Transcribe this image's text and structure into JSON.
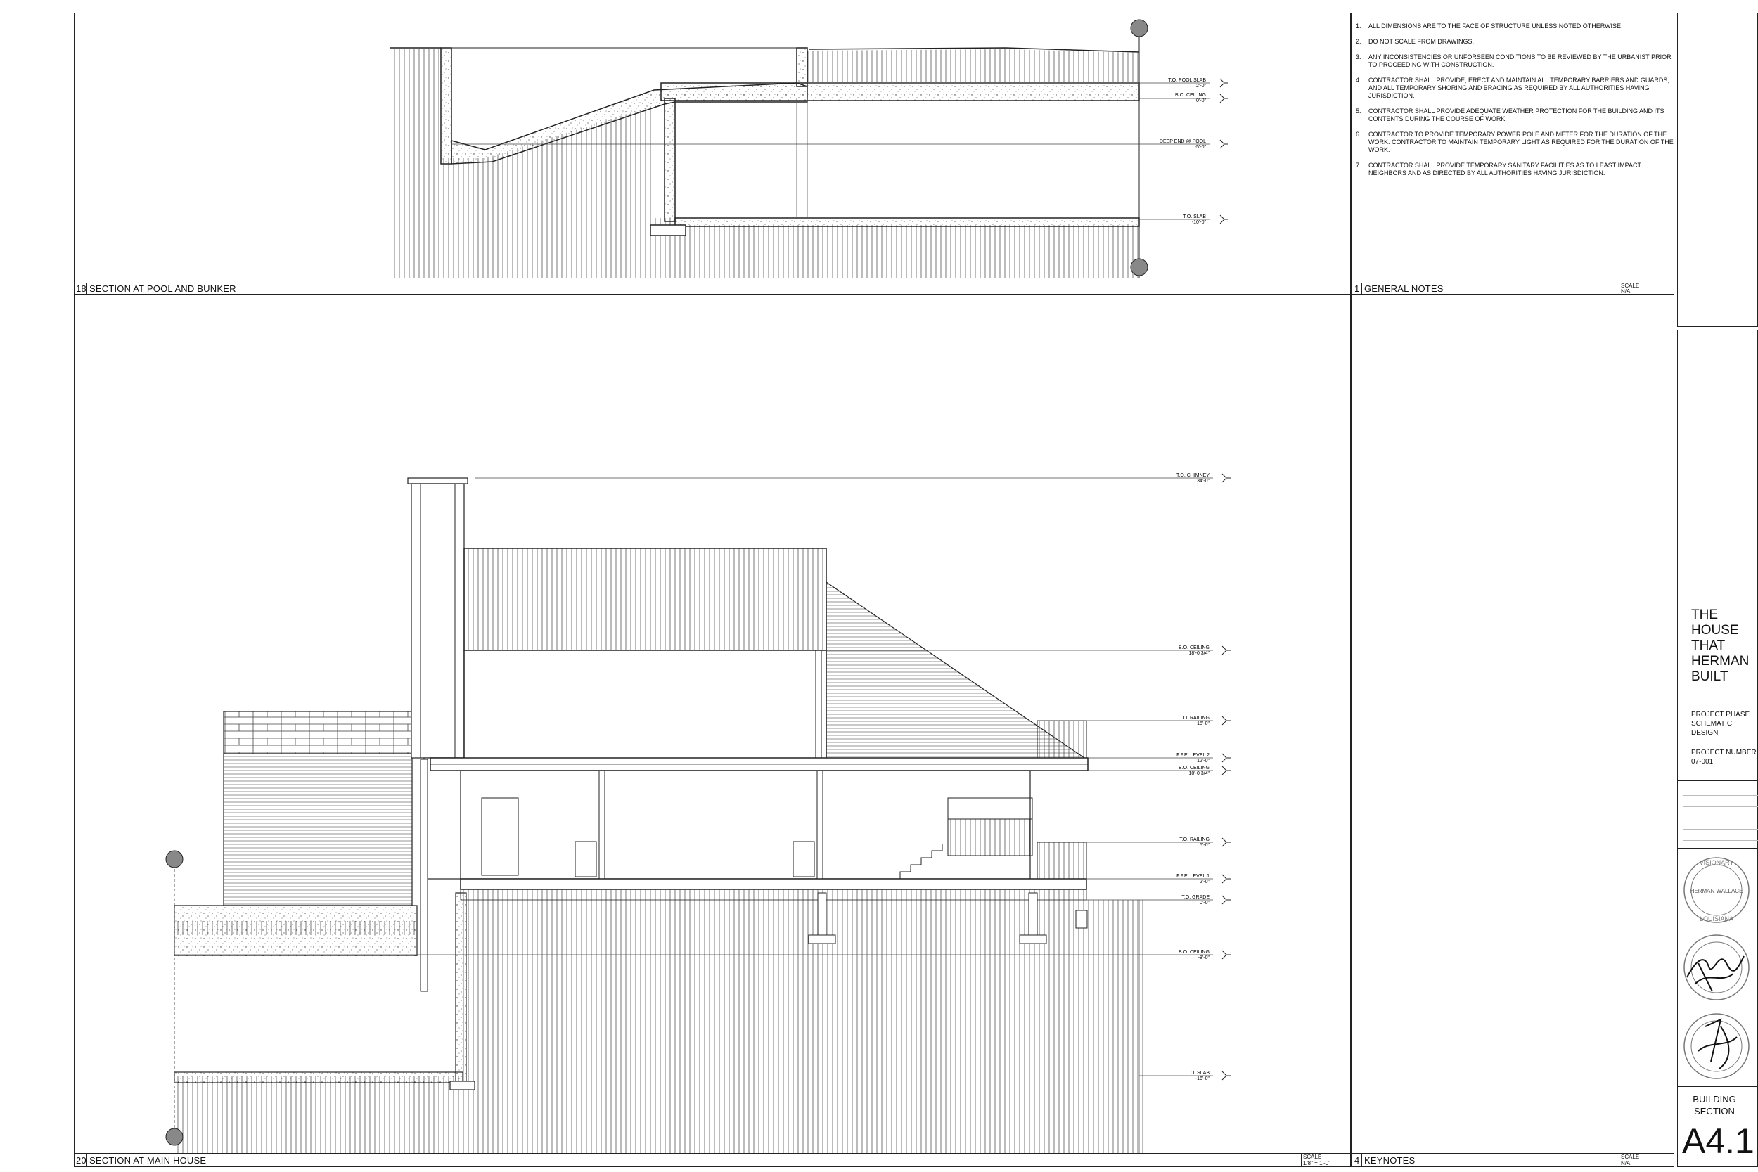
{
  "sheet": {
    "number": "A4.1",
    "sheet_title": "BUILDING SECTION",
    "project_name": "THE HOUSE THAT HERMAN BUILT",
    "project_phase_label": "PROJECT PHASE",
    "project_phase": "SCHEMATIC DESIGN",
    "project_number_label": "PROJECT NUMBER",
    "project_number": "07-001"
  },
  "panels": {
    "pool": {
      "index": "18",
      "title": "SECTION AT POOL AND BUNKER"
    },
    "notes": {
      "index": "1",
      "title": "GENERAL NOTES",
      "scale_label": "SCALE",
      "scale": "N/A"
    },
    "house": {
      "index": "20",
      "title": "SECTION AT MAIN HOUSE",
      "scale_label": "SCALE",
      "scale": "1/8\" = 1'-0\""
    },
    "keynotes": {
      "index": "4",
      "title": "KEYNOTES",
      "scale_label": "SCALE",
      "scale": "N/A"
    }
  },
  "general_notes": [
    {
      "num": "1.",
      "text": "ALL DIMENSIONS ARE TO THE FACE OF STRUCTURE UNLESS NOTED OTHERWISE."
    },
    {
      "num": "2.",
      "text": "DO NOT SCALE FROM DRAWINGS."
    },
    {
      "num": "3.",
      "text": "ANY INCONSISTENCIES OR UNFORSEEN CONDITIONS TO BE REVIEWED BY THE URBANIST PRIOR TO PROCEEDING WITH CONSTRUCTION."
    },
    {
      "num": "4.",
      "text": "CONTRACTOR SHALL PROVIDE, ERECT AND MAINTAIN ALL TEMPORARY BARRIERS AND GUARDS, AND ALL TEMPORARY SHORING AND BRACING AS REQUIRED BY ALL AUTHORITIES HAVING JURISDICTION."
    },
    {
      "num": "5.",
      "text": "CONTRACTOR SHALL PROVIDE ADEQUATE WEATHER PROTECTION FOR THE BUILDING AND ITS CONTENTS DURING THE COURSE OF WORK."
    },
    {
      "num": "6.",
      "text": "CONTRACTOR TO PROVIDE TEMPORARY POWER POLE AND METER FOR THE DURATION OF THE WORK. CONTRACTOR TO MAINTAIN TEMPORARY LIGHT AS REQUIRED FOR THE DURATION OF THE WORK."
    },
    {
      "num": "7.",
      "text": "CONTRACTOR SHALL PROVIDE TEMPORARY SANITARY FACILITIES AS TO LEAST IMPACT NEIGHBORS AND AS DIRECTED BY ALL AUTHORITIES HAVING JURISDICTION."
    }
  ],
  "pool_levels": [
    {
      "name": "T.O. POOL SLAB",
      "elev": "2'-0\""
    },
    {
      "name": "B.O. CEILING",
      "elev": "0'-0\""
    },
    {
      "name": "DEEP END @ POOL",
      "elev": "-5'-0\""
    },
    {
      "name": "T.O. SLAB",
      "elev": "-10'-0\""
    }
  ],
  "house_levels": [
    {
      "name": "T.O. CHIMNEY",
      "elev": "34'-0\""
    },
    {
      "name": "B.O. CEILING",
      "elev": "18'-0 3/4\""
    },
    {
      "name": "T.O. RAILING",
      "elev": "15'-0\""
    },
    {
      "name": "F.F.E. LEVEL 2",
      "elev": "12'-0\""
    },
    {
      "name": "B.O. CEILING",
      "elev": "10'-0 3/4\""
    },
    {
      "name": "T.O. RAILING",
      "elev": "5'-0\""
    },
    {
      "name": "F.F.E. LEVEL 1",
      "elev": "2'-0\""
    },
    {
      "name": "T.O. GRADE",
      "elev": "0'-0\""
    },
    {
      "name": "B.O. CEILING",
      "elev": "-8'-0\""
    },
    {
      "name": "T.O. SLAB",
      "elev": "-16'-0\""
    }
  ],
  "stamps": {
    "stamp1_ring": "VISIONARY",
    "stamp1_center": "HERMAN WALLACE",
    "stamp1_bottom": "LOUISIANA"
  }
}
